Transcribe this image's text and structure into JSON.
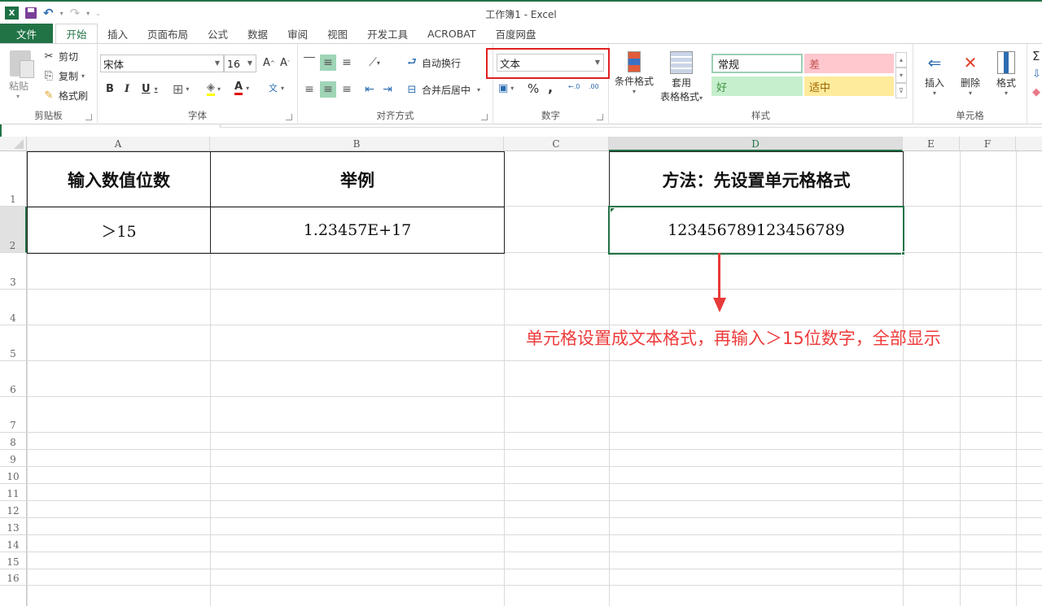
{
  "window": {
    "title": "工作簿1 - Excel"
  },
  "qat": {
    "logo": "X",
    "undo_dd": "▾",
    "redo_dd": "▾",
    "customize": "₌"
  },
  "tabs": [
    {
      "label": "文件"
    },
    {
      "label": "开始"
    },
    {
      "label": "插入"
    },
    {
      "label": "页面布局"
    },
    {
      "label": "公式"
    },
    {
      "label": "数据"
    },
    {
      "label": "审阅"
    },
    {
      "label": "视图"
    },
    {
      "label": "开发工具"
    },
    {
      "label": "ACROBAT"
    },
    {
      "label": "百度网盘"
    }
  ],
  "ribbon": {
    "clipboard": {
      "label": "剪贴板",
      "paste": "粘贴",
      "cut": "剪切",
      "copy": "复制",
      "format_painter": "格式刷"
    },
    "font": {
      "label": "字体",
      "font_name": "宋体",
      "font_size": "16",
      "bold": "B",
      "italic": "I",
      "underline": "U",
      "grow": "A",
      "shrink": "A",
      "phonetic": "文"
    },
    "alignment": {
      "label": "对齐方式",
      "wrap_text": "自动换行",
      "merge_center": "合并后居中"
    },
    "number": {
      "label": "数字",
      "format": "文本",
      "percent": "%",
      "comma": ",",
      "inc_decimal": "←.0",
      "dec_decimal": ".00"
    },
    "styles": {
      "label": "样式",
      "conditional": "条件格式",
      "table_format_1": "套用",
      "table_format_2": "表格格式",
      "normal": "常规",
      "bad": "差",
      "good": "好",
      "neutral": "适中"
    },
    "cells": {
      "label": "单元格",
      "insert": "插入",
      "delete": "删除",
      "format": "格式"
    },
    "editing": {
      "sum": "Σ"
    }
  },
  "sheet": {
    "columns": [
      "A",
      "B",
      "C",
      "D",
      "E",
      "F"
    ],
    "rows": [
      "1",
      "2",
      "3",
      "4",
      "5",
      "6",
      "7",
      "8",
      "9",
      "10",
      "11",
      "12",
      "13",
      "14",
      "15",
      "16"
    ],
    "cells": {
      "A1": "输入数值位数",
      "B1": "举例",
      "D1": "方法：先设置单元格格式",
      "A2": "＞15",
      "B2": "1.23457E+17",
      "D2": "123456789123456789"
    },
    "selected_cell": "D2",
    "annotation": "单元格设置成文本格式，再输入＞15位数字，全部显示"
  },
  "colors": {
    "accent": "#217346",
    "annotation": "#ee3b3b",
    "highlight_box": "#e02020"
  }
}
